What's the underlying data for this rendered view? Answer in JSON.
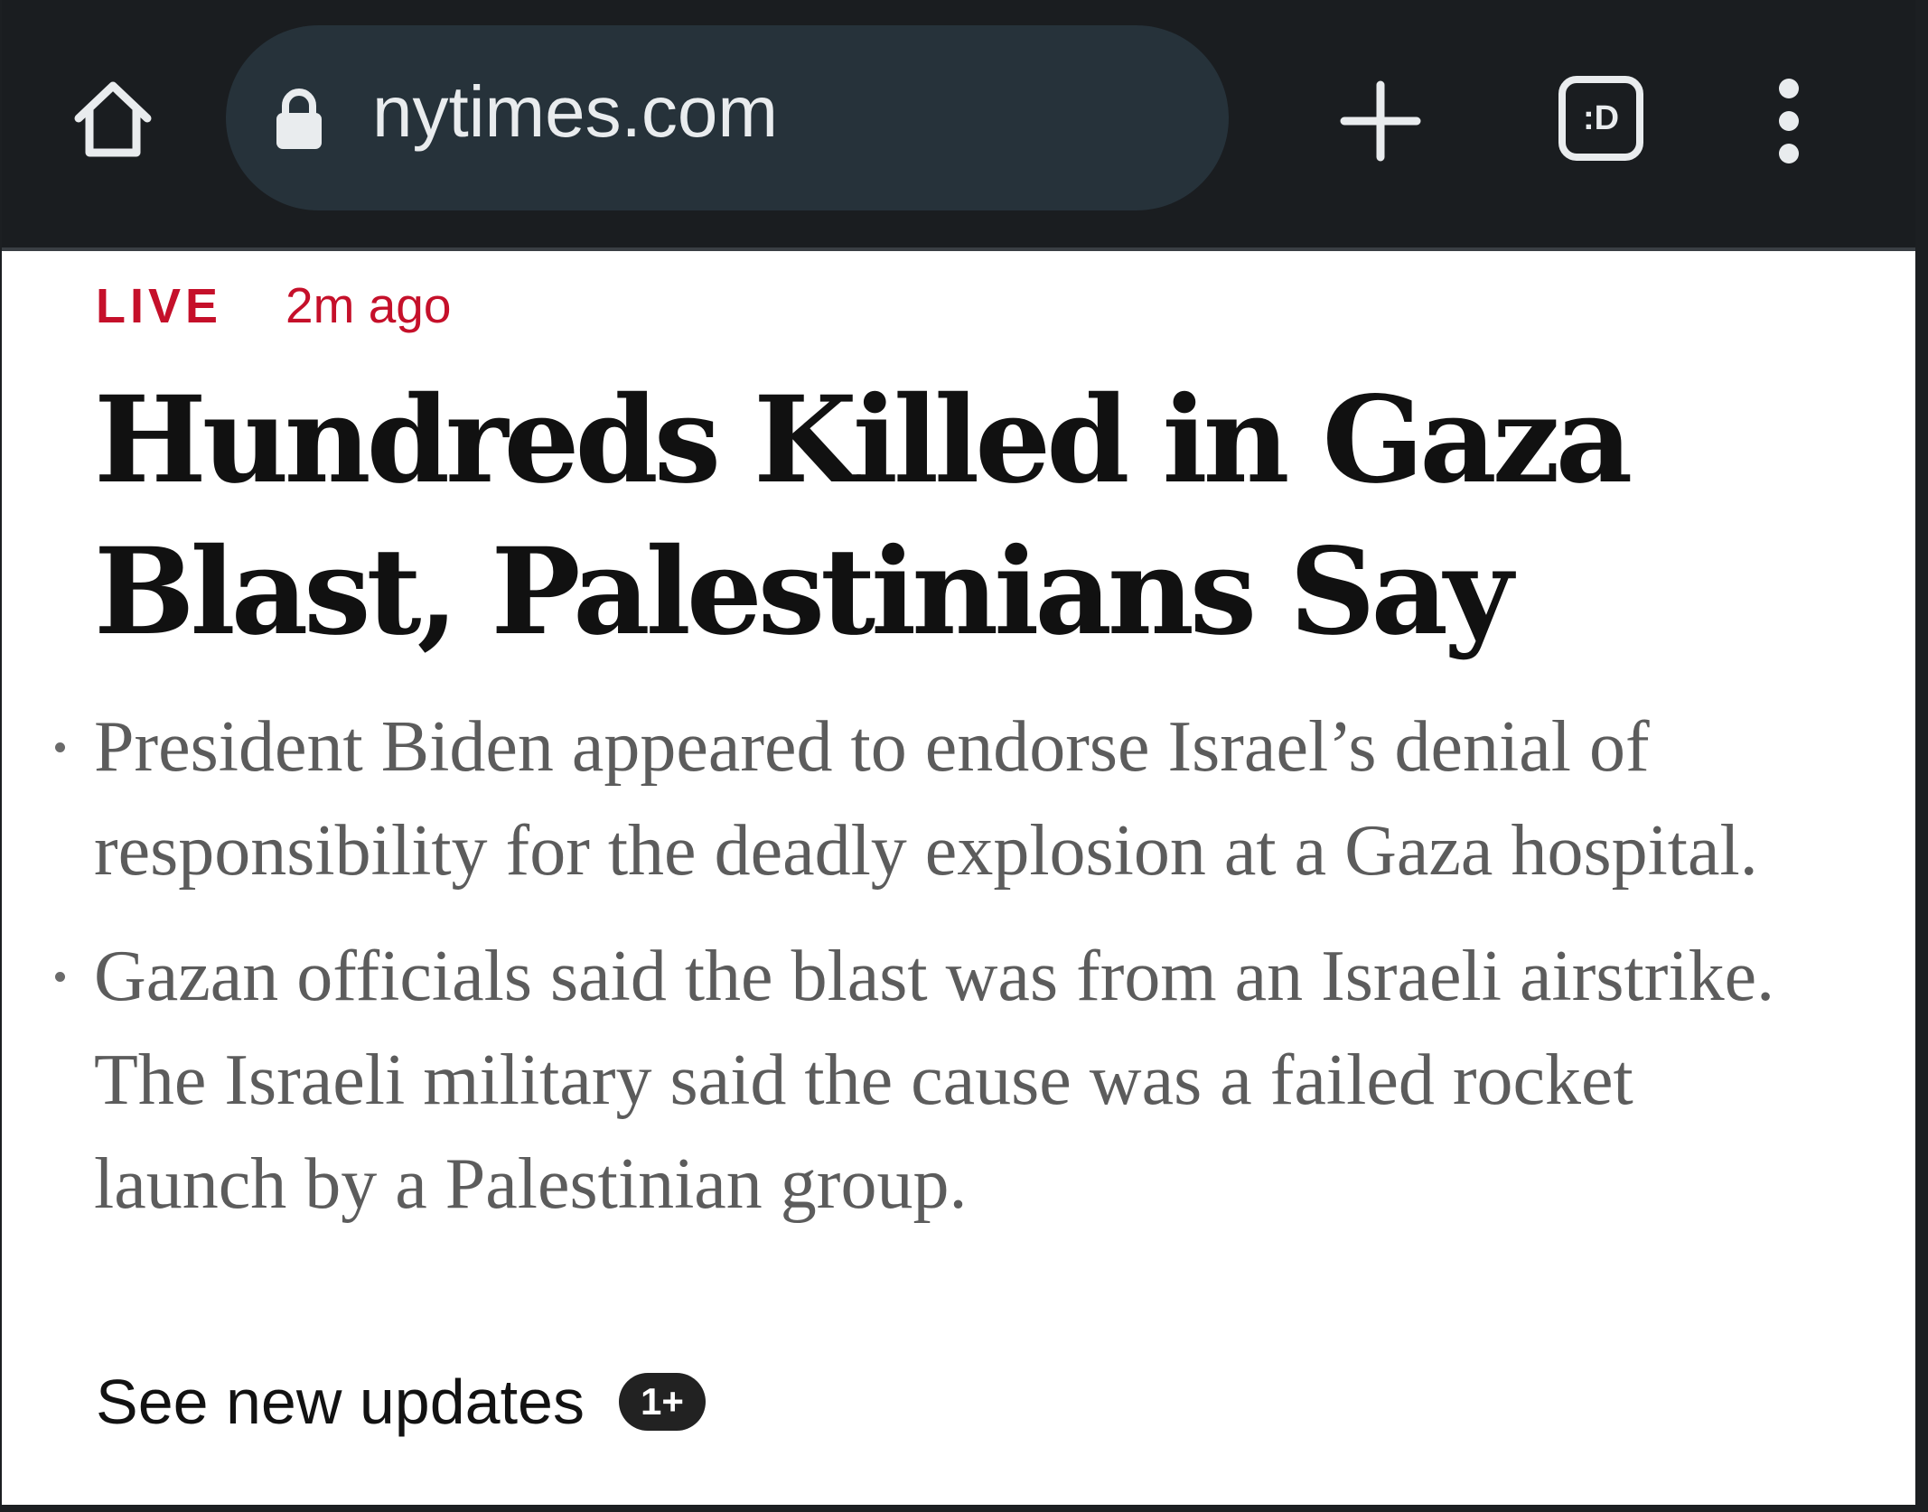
{
  "browser": {
    "url": "nytimes.com",
    "tabs_label": ":D",
    "icons": {
      "home": "home-icon",
      "lock": "lock-icon",
      "new_tab": "plus-icon",
      "tabs": "tab-switcher-icon",
      "menu": "more-vert-icon"
    },
    "colors": {
      "toolbar_bg": "#1a1d20",
      "url_bar_bg": "#26323a",
      "icon_fg": "#e9ecee"
    }
  },
  "article": {
    "live_label": "LIVE",
    "timestamp": "2m ago",
    "headline": "Hundreds Killed in Gaza Blast, Palestinians Say",
    "bullets": [
      "President Biden appeared to endorse Israel’s denial of responsibility for the deadly explosion at a Gaza hospital.",
      "Gazan officials said the blast was from an Israeli airstrike. The Israeli military said the cause was a failed rocket launch by a Palestinian group."
    ],
    "updates_label": "See new updates",
    "updates_badge": "1+",
    "colors": {
      "live_accent": "#c5102a",
      "headline": "#111111",
      "bullet_text": "#5c5c5c"
    }
  }
}
